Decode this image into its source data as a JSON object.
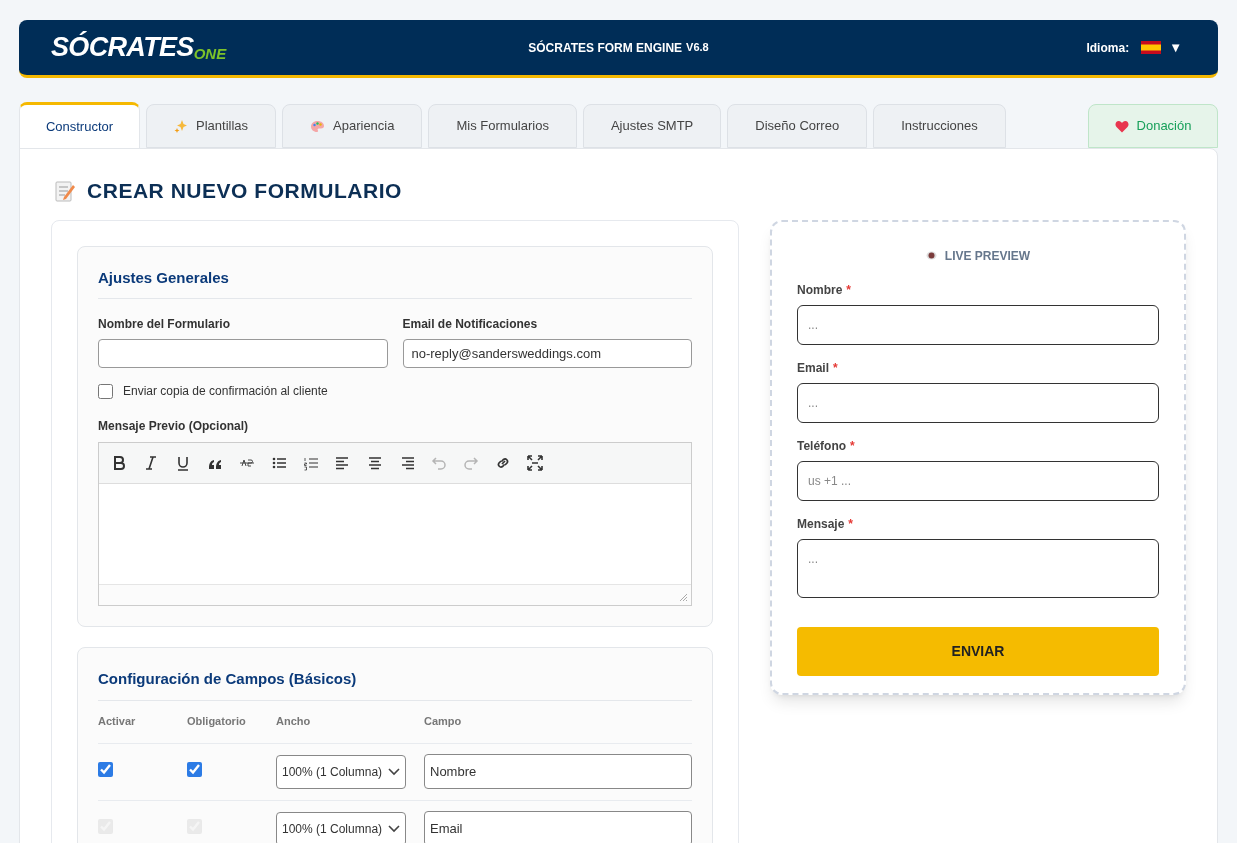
{
  "header": {
    "logo_main": "SÓCRATES",
    "logo_sub": "ONE",
    "title": "SÓCRATES FORM ENGINE",
    "version": "V6.8",
    "language_label": "Idioma:",
    "language_caret": "▼"
  },
  "tabs": [
    {
      "label": "Constructor",
      "selected": true,
      "kind": "normal"
    },
    {
      "label": "Plantillas",
      "selected": false,
      "kind": "templates"
    },
    {
      "label": "Apariencia",
      "selected": false,
      "kind": "appearance"
    },
    {
      "label": "Mis Formularios",
      "selected": false,
      "kind": "normal"
    },
    {
      "label": "Ajustes SMTP",
      "selected": false,
      "kind": "normal"
    },
    {
      "label": "Diseño Correo",
      "selected": false,
      "kind": "normal"
    },
    {
      "label": "Instrucciones",
      "selected": false,
      "kind": "normal"
    },
    {
      "label": "Donación",
      "selected": false,
      "kind": "donate"
    }
  ],
  "page_title": "CREAR NUEVO FORMULARIO",
  "general": {
    "title": "Ajustes Generales",
    "form_name": {
      "label": "Nombre del Formulario"
    },
    "notify_email": {
      "label": "Email de Notificaciones",
      "value": "no-reply@sandersweddings.com"
    },
    "copy_checkbox": {
      "label": "Enviar copia de confirmación al cliente",
      "checked": false
    },
    "message_label": "Mensaje Previo (Opcional)",
    "toolbar": [
      {
        "kind": "bold",
        "disabled": false
      },
      {
        "kind": "italic",
        "disabled": false
      },
      {
        "kind": "underline",
        "disabled": false
      },
      {
        "kind": "quote",
        "disabled": false
      },
      {
        "kind": "strike",
        "disabled": false
      },
      {
        "kind": "bullets",
        "disabled": false
      },
      {
        "kind": "numbers",
        "disabled": false
      },
      {
        "kind": "left",
        "disabled": false
      },
      {
        "kind": "center",
        "disabled": false
      },
      {
        "kind": "right",
        "disabled": false
      },
      {
        "kind": "undo",
        "disabled": true
      },
      {
        "kind": "redo",
        "disabled": true
      },
      {
        "kind": "link",
        "disabled": false
      },
      {
        "kind": "fullscreen",
        "disabled": false
      }
    ]
  },
  "fields": {
    "title": "Configuración de Campos (Básicos)",
    "columns": [
      "Activar",
      "Obligatorio",
      "Ancho",
      "Campo"
    ],
    "rows": [
      {
        "active": true,
        "required": true,
        "disabled": false,
        "width": "100% (1 Columna)",
        "field": "Nombre"
      },
      {
        "active": true,
        "required": true,
        "disabled": true,
        "width": "100% (1 Columna)",
        "field": "Email"
      }
    ]
  },
  "preview": {
    "title": "LIVE PREVIEW",
    "fields": [
      {
        "label": "Nombre",
        "required_mark": "*",
        "placeholder": "...",
        "kind": "input"
      },
      {
        "label": "Email",
        "required_mark": "*",
        "placeholder": "...",
        "kind": "input"
      },
      {
        "label": "Teléfono",
        "required_mark": "*",
        "placeholder": "us +1 ...",
        "kind": "input"
      },
      {
        "label": "Mensaje",
        "required_mark": "*",
        "placeholder": "...",
        "kind": "textarea"
      }
    ],
    "submit": "ENVIAR"
  }
}
